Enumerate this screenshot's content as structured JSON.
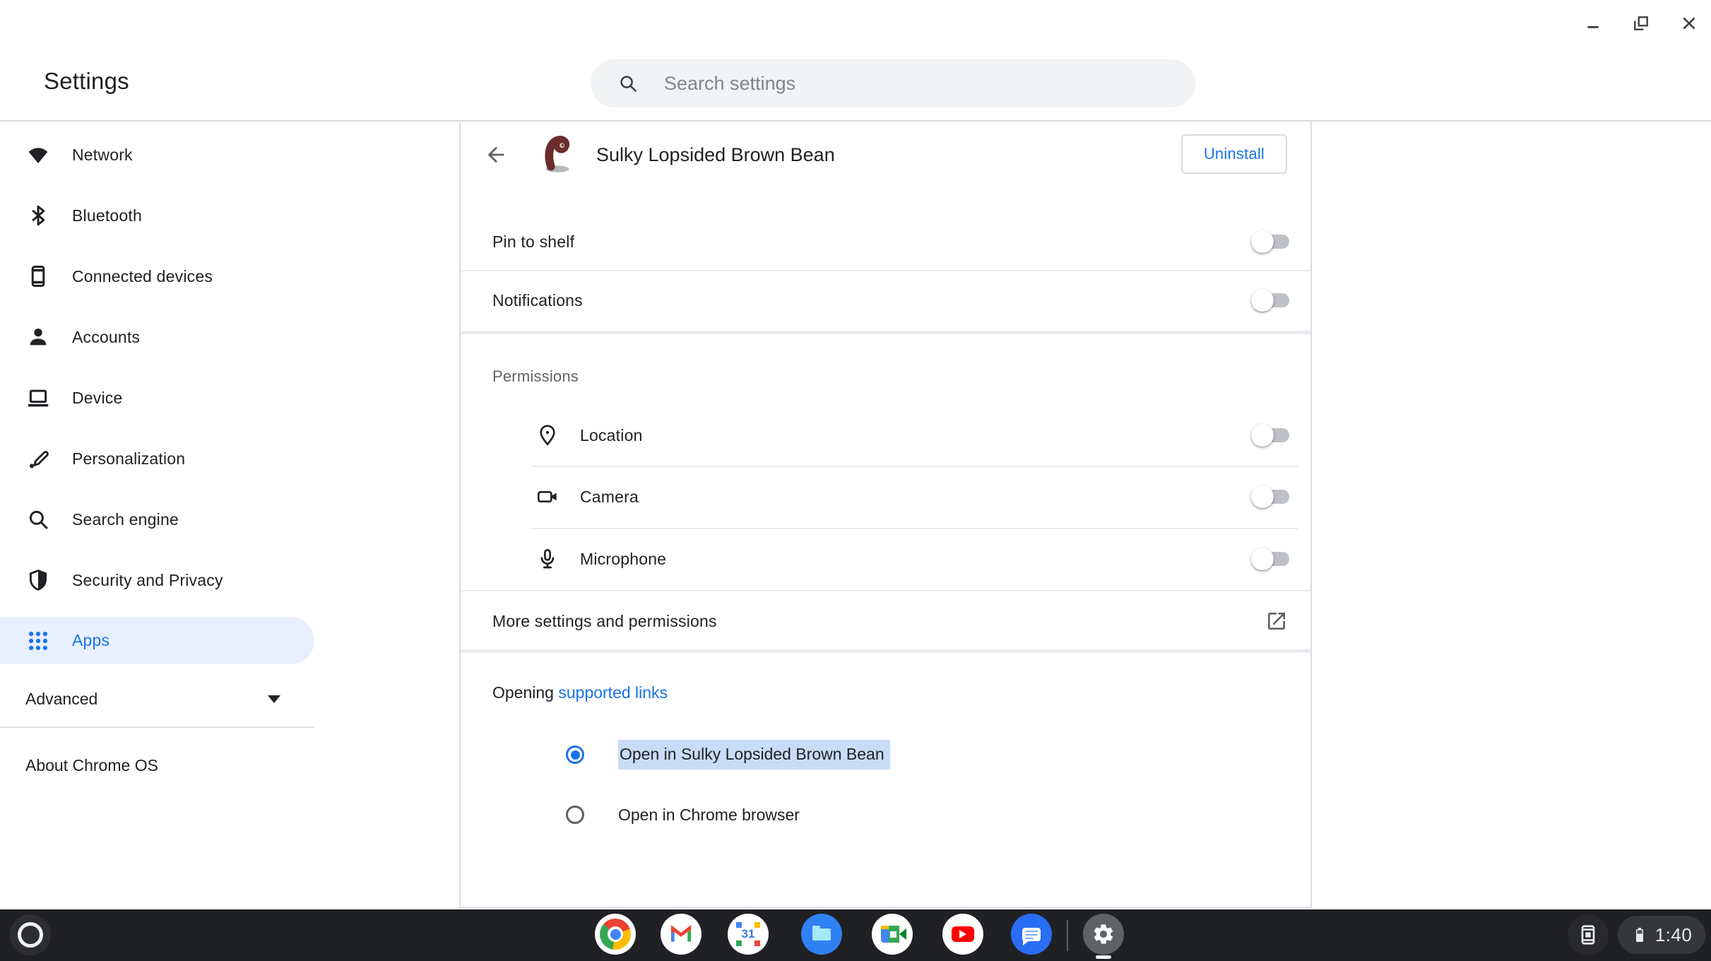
{
  "window": {
    "controls": {
      "minimize": "minimize",
      "restore": "restore",
      "close": "close"
    }
  },
  "header": {
    "title": "Settings",
    "search": {
      "placeholder": "Search settings",
      "value": ""
    }
  },
  "sidebar": {
    "items": [
      {
        "label": "Network",
        "icon": "wifi-icon",
        "selected": false
      },
      {
        "label": "Bluetooth",
        "icon": "bluetooth-icon",
        "selected": false
      },
      {
        "label": "Connected devices",
        "icon": "smartphone-icon",
        "selected": false
      },
      {
        "label": "Accounts",
        "icon": "person-icon",
        "selected": false
      },
      {
        "label": "Device",
        "icon": "laptop-icon",
        "selected": false
      },
      {
        "label": "Personalization",
        "icon": "pen-icon",
        "selected": false
      },
      {
        "label": "Search engine",
        "icon": "search-icon",
        "selected": false
      },
      {
        "label": "Security and Privacy",
        "icon": "shield-icon",
        "selected": false
      },
      {
        "label": "Apps",
        "icon": "apps-grid-icon",
        "selected": true
      }
    ],
    "advanced": {
      "label": "Advanced",
      "expanded": false
    },
    "about": {
      "label": "About Chrome OS"
    }
  },
  "app_page": {
    "title": "Sulky Lopsided Brown Bean",
    "uninstall_label": "Uninstall",
    "toggles": {
      "pin_to_shelf": {
        "label": "Pin to shelf",
        "enabled": false
      },
      "notifications": {
        "label": "Notifications",
        "enabled": false
      }
    },
    "permissions": {
      "heading": "Permissions",
      "items": [
        {
          "label": "Location",
          "icon": "location-pin-icon",
          "enabled": false
        },
        {
          "label": "Camera",
          "icon": "video-camera-icon",
          "enabled": false
        },
        {
          "label": "Microphone",
          "icon": "microphone-icon",
          "enabled": false
        }
      ]
    },
    "more_settings": {
      "label": "More settings and permissions",
      "icon": "open-in-new-icon"
    },
    "opening": {
      "prefix": "Opening",
      "link_label": "supported links",
      "options": [
        {
          "label": "Open in Sulky Lopsided Brown Bean",
          "selected": true,
          "highlighted": true
        },
        {
          "label": "Open in Chrome browser",
          "selected": false,
          "highlighted": false
        }
      ]
    }
  },
  "shelf": {
    "apps": [
      "Chrome",
      "Gmail",
      "Calendar",
      "Files",
      "Meet",
      "YouTube",
      "Messages",
      "Settings"
    ],
    "active_app": "Settings",
    "status": {
      "time": "1:40"
    }
  },
  "colors": {
    "accent": "#1a73e8",
    "selected_bg": "#e8f0fe",
    "selection_highlight": "#c8dcf7",
    "shelf_bg": "#202124",
    "divider": "#e0e3e7",
    "text_primary": "#202124",
    "text_secondary": "#5f6368"
  }
}
